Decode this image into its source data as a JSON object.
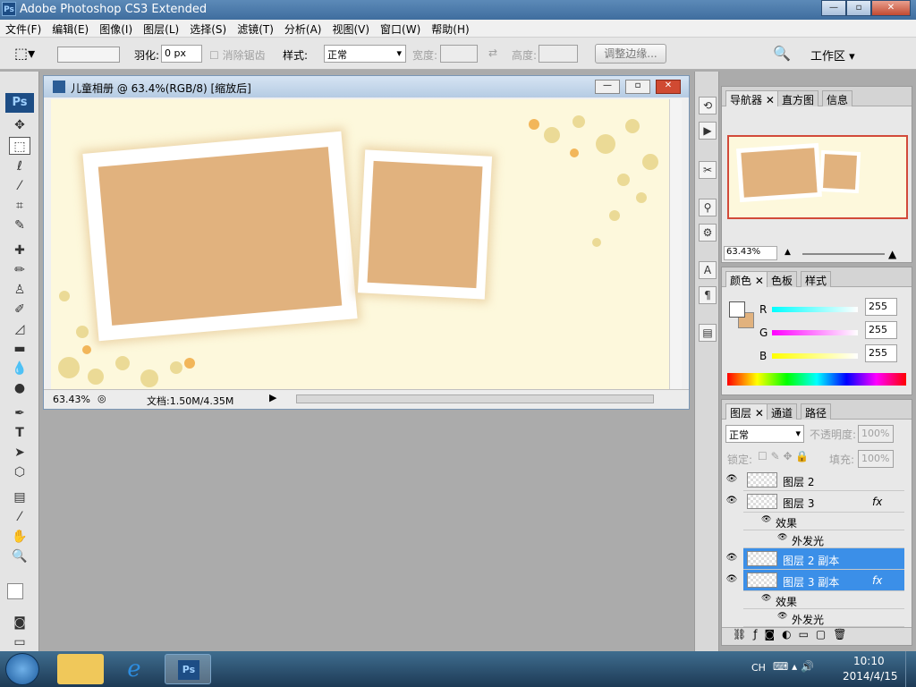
{
  "app": {
    "title": "Adobe Photoshop CS3 Extended",
    "logo": "Ps"
  },
  "window_buttons": {
    "minimize": "—",
    "restore": "▫",
    "close": "✕"
  },
  "menu": [
    "文件(F)",
    "编辑(E)",
    "图像(I)",
    "图层(L)",
    "选择(S)",
    "滤镜(T)",
    "分析(A)",
    "视图(V)",
    "窗口(W)",
    "帮助(H)"
  ],
  "options": {
    "feather_label": "羽化:",
    "feather_value": "0 px",
    "antialias_label": "消除锯齿",
    "style_label": "样式:",
    "style_value": "正常",
    "width_label": "宽度:",
    "height_label": "高度:",
    "refine_button": "调整边缘...",
    "workspace_label": "工作区 ▾"
  },
  "document": {
    "title": "儿童相册 @ 63.4%(RGB/8) [缩放后]",
    "zoom": "63.43%",
    "doc_info": "文档:1.50M/4.35M",
    "canvas_color": "#fdf8dc",
    "photo_color": "#e1b27e"
  },
  "navigator": {
    "tabs": [
      "导航器",
      "直方图",
      "信息"
    ],
    "zoom": "63.43%"
  },
  "color": {
    "tabs": [
      "颜色",
      "色板",
      "样式"
    ],
    "r_label": "R",
    "g_label": "G",
    "b_label": "B",
    "r": "255",
    "g": "255",
    "b": "255"
  },
  "layers": {
    "tabs": [
      "图层",
      "通道",
      "路径"
    ],
    "blend_mode": "正常",
    "opacity_label": "不透明度:",
    "opacity": "100%",
    "lock_label": "锁定:",
    "fill_label": "填充:",
    "fill": "100%",
    "rows": [
      {
        "name": "图层 2",
        "fx": ""
      },
      {
        "name": "图层 3",
        "fx": "fx"
      },
      {
        "name": "效果",
        "fx": ""
      },
      {
        "name": "外发光",
        "fx": ""
      },
      {
        "name": "图层 2 副本",
        "fx": ""
      },
      {
        "name": "图层 3 副本",
        "fx": "fx"
      },
      {
        "name": "效果",
        "fx": ""
      },
      {
        "name": "外发光",
        "fx": ""
      }
    ]
  },
  "taskbar": {
    "lang": "CH",
    "time": "10:10",
    "date": "2014/4/15"
  }
}
